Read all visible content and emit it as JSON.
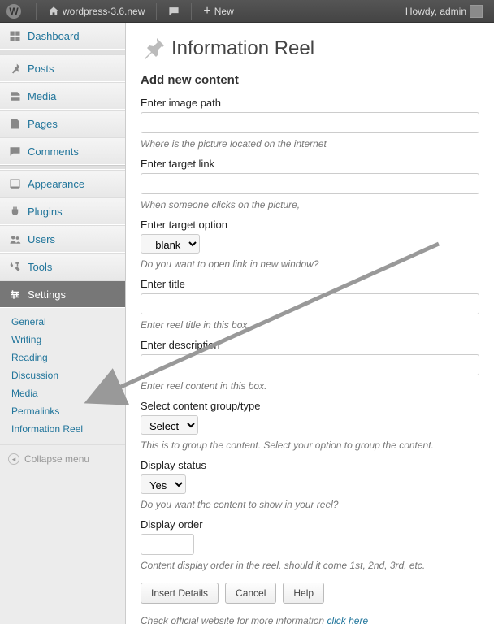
{
  "adminbar": {
    "site_name": "wordpress-3.6.new",
    "new_label": "New",
    "greeting": "Howdy, admin"
  },
  "sidebar": {
    "items": [
      {
        "label": "Dashboard"
      },
      {
        "label": "Posts"
      },
      {
        "label": "Media"
      },
      {
        "label": "Pages"
      },
      {
        "label": "Comments"
      },
      {
        "label": "Appearance"
      },
      {
        "label": "Plugins"
      },
      {
        "label": "Users"
      },
      {
        "label": "Tools"
      },
      {
        "label": "Settings"
      }
    ],
    "submenu": [
      "General",
      "Writing",
      "Reading",
      "Discussion",
      "Media",
      "Permalinks",
      "Information Reel"
    ],
    "collapse_label": "Collapse menu"
  },
  "page": {
    "title": "Information Reel",
    "section": "Add new content",
    "fields": {
      "image_path_label": "Enter image path",
      "image_path_hint": "Where is the picture located on the internet",
      "target_link_label": "Enter target link",
      "target_link_hint": "When someone clicks on the picture,",
      "target_option_label": "Enter target option",
      "target_option_value": "_blank",
      "target_option_hint": "Do you want to open link in new window?",
      "title_label": "Enter title",
      "title_hint": "Enter reel title in this box.",
      "description_label": "Enter description",
      "description_hint": "Enter reel content in this box.",
      "group_label": "Select content group/type",
      "group_value": "Select",
      "group_hint": "This is to group the content. Select your option to group the content.",
      "display_status_label": "Display status",
      "display_status_value": "Yes",
      "display_status_hint": "Do you want the content to show in your reel?",
      "display_order_label": "Display order",
      "display_order_hint": "Content display order in the reel. should it come 1st, 2nd, 3rd, etc."
    },
    "buttons": {
      "insert": "Insert Details",
      "cancel": "Cancel",
      "help": "Help"
    },
    "footnote_text": "Check official website for more information ",
    "footnote_link": "click here"
  }
}
